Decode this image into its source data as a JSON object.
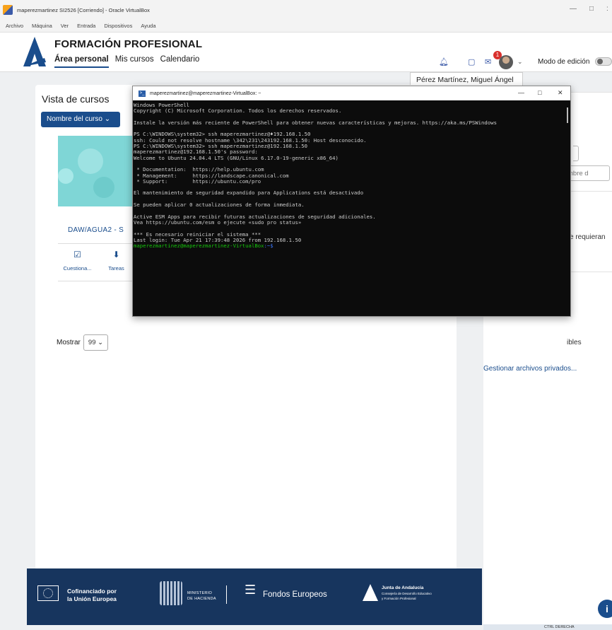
{
  "host": {
    "title": "maperezmartinez SI2526 [Corriendo] - Oracle VirtualBox",
    "menu": [
      "Archivo",
      "Máquina",
      "Ver",
      "Entrada",
      "Dispositivos",
      "Ayuda"
    ],
    "controls": [
      "—",
      "□",
      ":"
    ]
  },
  "moodle": {
    "brand": "FORMACIÓN PROFESIONAL",
    "nav": [
      "Área personal",
      "Mis cursos",
      "Calendario"
    ],
    "notification_count": "1",
    "edit_mode_label": "Modo de edición",
    "user_tooltip": "Pérez Martínez, Miguel Ángel",
    "courses_title": "Vista de cursos",
    "sort_button": "Nombre del curso ⌄",
    "course_name": "DAW/AGUA2 - S",
    "activities": [
      {
        "icon": "☑",
        "label": "Cuestiona..."
      },
      {
        "icon": "⬇",
        "label": "Tareas"
      }
    ],
    "show_label": "Mostrar",
    "show_value": "99 ⌄",
    "drawer": {
      "search_placeholder": "mbre d",
      "text1": "e requieran",
      "text2": "ibles",
      "link": "Gestionar archivos privados..."
    },
    "info_button": "i",
    "footer": {
      "eu_line1": "Cofinanciado por",
      "eu_line2": "la Unión Europea",
      "ministry_line1": "MINISTERIO",
      "ministry_line2": "DE HACIENDA",
      "funds": "Fondos Europeos",
      "junta": "Junta de Andalucía",
      "junta_sub1": "Consejería de Desarrollo Educativo",
      "junta_sub2": "y Formación Profesional"
    }
  },
  "terminal": {
    "title": "maperezmartinez@maperezmartinez-VirtualBox: ~",
    "controls": [
      "—",
      "□",
      "✕"
    ],
    "lines": [
      "Windows PowerShell",
      "Copyright (C) Microsoft Corporation. Todos los derechos reservados.",
      "",
      "Instale la versión más reciente de PowerShell para obtener nuevas características y mejoras. https://aka.ms/PSWindows",
      "",
      "PS C:\\WINDOWS\\system32> ssh maperezmartinez@♦192.168.1.50",
      "ssh: Could not resolve hostname \\342\\231\\243192.168.1.50: Host desconocido.",
      "PS C:\\WINDOWS\\system32> ssh maperezmartinez@192.168.1.50",
      "maperezmartinez@192.168.1.50's password:",
      "Welcome to Ubuntu 24.04.4 LTS (GNU/Linux 6.17.0-19-generic x86_64)",
      "",
      " * Documentation:  https://help.ubuntu.com",
      " * Management:     https://landscape.canonical.com",
      " * Support:        https://ubuntu.com/pro",
      "",
      "El mantenimiento de seguridad expandido para Applications está desactivado",
      "",
      "Se pueden aplicar 0 actualizaciones de forma inmediata.",
      "",
      "Active ESM Apps para recibir futuras actualizaciones de seguridad adicionales.",
      "Vea https://ubuntu.com/esm o ejecute «sudo pro status»",
      "",
      "*** Es necesario reiniciar el sistema ***",
      "Last login: Tue Apr 21 17:39:48 2026 from 192.168.1.50"
    ],
    "prompt_user": "maperezmartinez@maperezmartinez-VirtualBox",
    "prompt_path": ":~$"
  },
  "tray_text": "CTRL DERECHA"
}
